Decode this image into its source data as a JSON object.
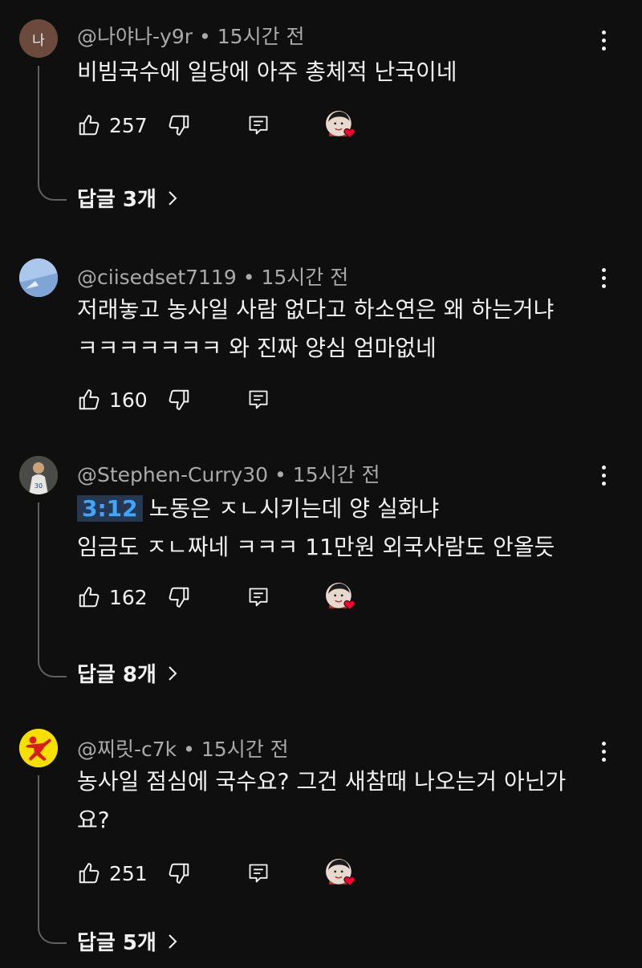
{
  "comments": [
    {
      "author": "@나야나-y9r",
      "age": "15시간 전",
      "avatar_letter": "나",
      "lines": [
        "비빔국수에 일당에 아주 총체적 난국이네"
      ],
      "likes": "257",
      "creator_heart": true,
      "replies_label": "답글 3개"
    },
    {
      "author": "@ciisedset7119",
      "age": "15시간 전",
      "lines": [
        "저래놓고 농사일 사람 없다고 하소연은 왜 하는거냐",
        "ㅋㅋㅋㅋㅋㅋㅋ 와 진짜 양심 엄마없네"
      ],
      "likes": "160",
      "creator_heart": false
    },
    {
      "author": "@Stephen-Curry30",
      "age": "15시간 전",
      "timestamp": "3:12",
      "lines": [
        "노동은 ㅈㄴ시키는데 양 실화냐",
        "임금도 ㅈㄴ짜네 ㅋㅋㅋ 11만원 외국사람도 안올듯"
      ],
      "likes": "162",
      "creator_heart": true,
      "replies_label": "답글 8개"
    },
    {
      "author": "@찌릿-c7k",
      "age": "15시간 전",
      "lines": [
        "농사일 점심에 국수요? 그건 새참때 나오는거 아닌가",
        "요?"
      ],
      "likes": "251",
      "creator_heart": true,
      "replies_label": "답글 5개"
    }
  ],
  "colors": {
    "background": "#0f0f0f",
    "text": "#f1f1f1",
    "meta": "#aaaaaa",
    "timestamp_link": "#3ea6ff",
    "heart": "#ff0033"
  }
}
